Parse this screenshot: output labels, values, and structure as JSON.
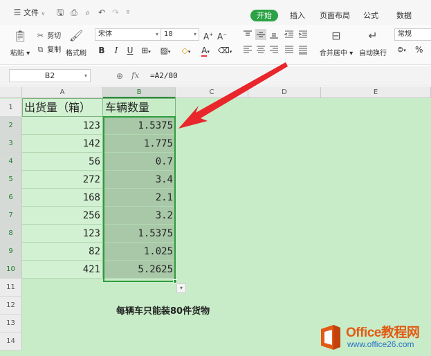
{
  "menubar": {
    "file_label": "文件",
    "tabs": [
      {
        "label": "开始",
        "active": true
      },
      {
        "label": "插入"
      },
      {
        "label": "页面布局"
      },
      {
        "label": "公式"
      },
      {
        "label": "数据"
      }
    ]
  },
  "ribbon": {
    "paste_label": "粘贴",
    "cut_label": "剪切",
    "copy_label": "复制",
    "format_painter_label": "格式刷",
    "font_name": "宋体",
    "font_size": "18",
    "bold": "B",
    "italic": "I",
    "underline": "U",
    "merge_center_label": "合并居中",
    "wrap_text_label": "自动换行",
    "number_format": "常规",
    "percent": "%",
    "font_color_glyph": "A"
  },
  "formula_bar": {
    "name_box": "B2",
    "fx_label": "fx",
    "formula": "=A2/80"
  },
  "sheet": {
    "columns": [
      "A",
      "B",
      "C",
      "D",
      "E"
    ],
    "rows": [
      "1",
      "2",
      "3",
      "4",
      "5",
      "6",
      "7",
      "8",
      "9",
      "10",
      "11",
      "12",
      "13",
      "14"
    ],
    "header_a": "出货量（箱）",
    "header_b": "车辆数量",
    "shipments": [
      "123",
      "142",
      "56",
      "272",
      "168",
      "256",
      "123",
      "82",
      "421"
    ],
    "vehicles": [
      "1.5375",
      "1.775",
      "0.7",
      "3.4",
      "2.1",
      "3.2",
      "1.5375",
      "1.025",
      "5.2625"
    ],
    "note": "每辆车只能装80件货物",
    "active_cell": "B2"
  },
  "watermark": {
    "title": "Office教程网",
    "url": "www.office26.com"
  },
  "colors": {
    "accent": "#2ba245",
    "grid_bg": "#c8ecc8",
    "selection_bg": "#a8c8a8",
    "arrow": "#e8262b",
    "watermark_orange": "#e25a14"
  }
}
